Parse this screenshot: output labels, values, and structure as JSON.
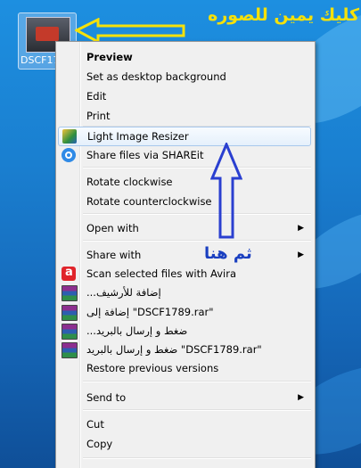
{
  "desktop": {
    "icon_name": "DSCF17"
  },
  "annotations": {
    "hint_top": "كليك يمين للصوره",
    "hint_mid": "ثم هنا"
  },
  "colors": {
    "menu_bg": "#f0f0f0",
    "highlight_border": "#a8c8ec",
    "annotation_yellow": "#f5e10a",
    "annotation_blue": "#1a3fc0"
  },
  "menu": {
    "items": [
      {
        "label": "Preview",
        "icon": "",
        "bold": true
      },
      {
        "label": "Set as desktop background",
        "icon": ""
      },
      {
        "label": "Edit",
        "icon": ""
      },
      {
        "label": "Print",
        "icon": ""
      },
      {
        "label": "Light Image Resizer",
        "icon": "light-image-resizer-icon",
        "highlighted": true
      },
      {
        "label": "Share files via SHAREit",
        "icon": "shareit-icon"
      },
      {
        "label": "Rotate clockwise",
        "icon": ""
      },
      {
        "label": "Rotate counterclockwise",
        "icon": ""
      },
      {
        "label": "Open with",
        "icon": "",
        "submenu": true
      },
      {
        "label": "Share with",
        "icon": "",
        "submenu": true
      },
      {
        "label": "Scan selected files with Avira",
        "icon": "avira-icon"
      },
      {
        "label": "...إضافة للأرشيف",
        "icon": "winrar-icon"
      },
      {
        "label": "إضافة إلى \"DSCF1789.rar\"",
        "icon": "winrar-icon"
      },
      {
        "label": "...ضغط و إرسال بالبريد",
        "icon": "winrar-icon"
      },
      {
        "label": "ضغط و إرسال بالبريد \"DSCF1789.rar\"",
        "icon": "winrar-icon"
      },
      {
        "label": "Restore previous versions",
        "icon": ""
      },
      {
        "label": "Send to",
        "icon": "",
        "submenu": true
      },
      {
        "label": "Cut",
        "icon": ""
      },
      {
        "label": "Copy",
        "icon": ""
      }
    ],
    "submenu_glyph": "▶"
  }
}
